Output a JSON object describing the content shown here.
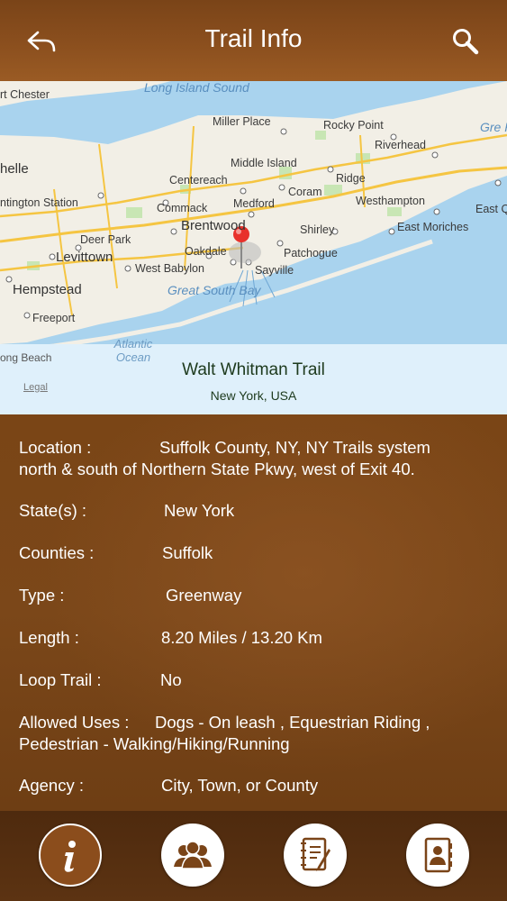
{
  "header": {
    "title": "Trail Info"
  },
  "map": {
    "labels": {
      "port_chester": "rt Chester",
      "long_island_sound": "Long Island Sound",
      "miller_place": "Miller Place",
      "rocky_point": "Rocky Point",
      "riverhead": "Riverhead",
      "great_peconic_bay": "Gre Pec Ba",
      "shelle": "helle",
      "middle_island": "Middle Island",
      "centereach": "Centereach",
      "ridge": "Ridge",
      "coram": "Coram",
      "huntington_station": "ntington Station",
      "commack": "Commack",
      "medford": "Medford",
      "westhampton": "Westhampton",
      "east_q": "East Q",
      "brentwood": "Brentwood",
      "shirley": "Shirley",
      "east_moriches": "East Moriches",
      "deer_park": "Deer Park",
      "oakdale": "Oakdale",
      "patchogue": "Patchogue",
      "levittown": "Levittown",
      "west_babylon": "West Babylon",
      "sayville": "Sayville",
      "hempstead": "Hempstead",
      "great_south_bay": "Great South Bay",
      "freeport": "Freeport",
      "atlantic_ocean": "Atlantic Ocean",
      "long_beach": "ong Beach",
      "legal": "Legal"
    },
    "colors": {
      "water": "#a9d3ee",
      "land": "#f2efe6",
      "park": "#c8e6b4",
      "highway": "#f5c542",
      "pin": "#e8312b"
    }
  },
  "trail": {
    "name": "Walt Whitman Trail",
    "place": "New York, USA"
  },
  "details": {
    "location_key": "Location  :",
    "location_val1": "Suffolk County, NY, NY Trails system",
    "location_val2": "north & south of Northern State Pkwy, west of Exit 40.",
    "state_key": "State(s)  :",
    "state_val": "New York",
    "counties_key": "Counties  :",
    "counties_val": "Suffolk",
    "type_key": "Type   :",
    "type_val": "Greenway",
    "length_key": "Length  :",
    "length_val": "8.20 Miles / 13.20 Km",
    "loop_key": "Loop Trail  :",
    "loop_val": "No",
    "uses_key": "Allowed Uses  :",
    "uses_val1": "Dogs - On leash , Equestrian  Riding ,",
    "uses_val2": "Pedestrian - Walking/Hiking/Running",
    "agency_key": "Agency  :",
    "agency_val": "City, Town, or County"
  },
  "tabs": {
    "icons": [
      "info-icon",
      "group-icon",
      "notes-icon",
      "contacts-icon"
    ],
    "colors": {
      "active": "#8b4d1c",
      "inactive": "#ffffff",
      "glyph": "#7a4418"
    }
  }
}
